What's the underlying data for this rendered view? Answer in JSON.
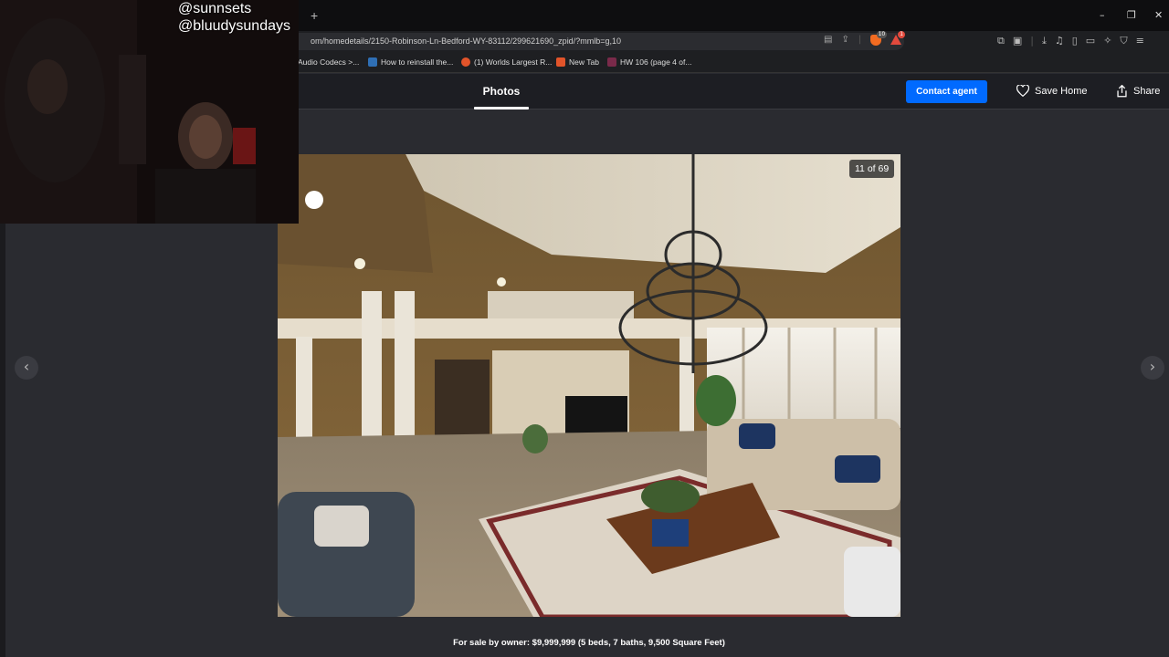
{
  "browser": {
    "new_tab_symbol": "+",
    "url": "om/homedetails/2150-Robinson-Ln-Bedford-WY-83112/299621690_zpid/?mmlb=g,10",
    "shield_badge": "10",
    "rewards_badge": "1",
    "window_controls": [
      "–",
      "❐",
      "✕"
    ]
  },
  "bookmarks": [
    {
      "label": "Audio Codecs >...",
      "icon_color": "#1e1f22"
    },
    {
      "label": "How to reinstall the...",
      "icon_color": "#2f6fb5"
    },
    {
      "label": "(1) Worlds Largest R...",
      "icon_color": "#e2542a"
    },
    {
      "label": "New Tab",
      "icon_color": "#e2542a"
    },
    {
      "label": "HW 106 (page 4 of...",
      "icon_color": "#7a2a4a"
    }
  ],
  "header": {
    "photos_tab": "Photos",
    "contact_agent": "Contact agent",
    "save_home": "Save Home",
    "share": "Share",
    "accent_color": "#006aff"
  },
  "viewer": {
    "counter": "11 of 69",
    "prev_symbol": "‹",
    "next_symbol": "›",
    "caption": "For sale by owner: $9,999,999 (5 beds, 7 baths, 9,500 Square Feet)"
  },
  "webcam": {
    "handle_1": "@sunnsets",
    "handle_2": "@bluudysundays"
  }
}
